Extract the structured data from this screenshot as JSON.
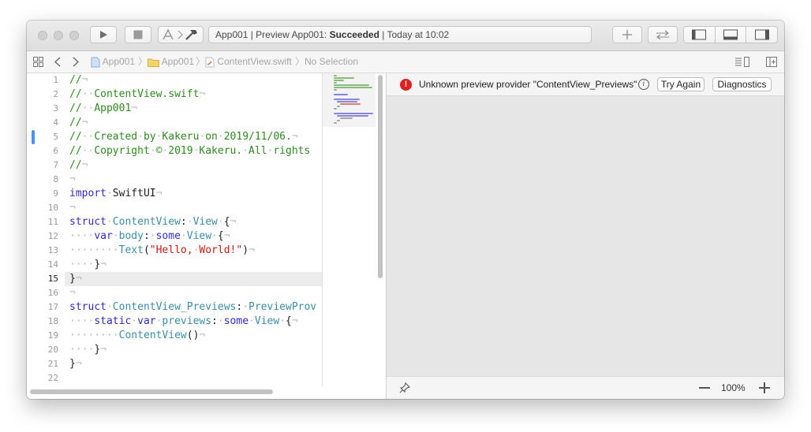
{
  "toolbar": {
    "activity": {
      "prefix": "App001 | Preview App001: ",
      "status": "Succeeded",
      "suffix": " | Today at 10:02"
    }
  },
  "jumpbar": {
    "project": "App001",
    "group": "App001",
    "file": "ContentView.swift",
    "selection": "No Selection"
  },
  "editor": {
    "current_line": 15,
    "lines": [
      {
        "n": "1",
        "text": "//¬"
      },
      {
        "n": "2",
        "text": "//··ContentView.swift¬"
      },
      {
        "n": "3",
        "text": "//··App001¬"
      },
      {
        "n": "4",
        "text": "//¬"
      },
      {
        "n": "5",
        "text": "//··Created·by·Kakeru·on·2019/11/06.¬"
      },
      {
        "n": "6",
        "text": "//··Copyright·©·2019·Kakeru.·All·rights"
      },
      {
        "n": "7",
        "text": "//¬"
      },
      {
        "n": "8",
        "text": "¬"
      },
      {
        "n": "9",
        "text": "import·SwiftUI¬"
      },
      {
        "n": "10",
        "text": "¬"
      },
      {
        "n": "11",
        "text": "struct·ContentView:·View·{¬"
      },
      {
        "n": "12",
        "text": "····var·body:·some·View·{¬"
      },
      {
        "n": "13",
        "text": "········Text(\"Hello,·World!\")¬"
      },
      {
        "n": "14",
        "text": "····}¬"
      },
      {
        "n": "15",
        "text": "}¬"
      },
      {
        "n": "16",
        "text": "¬"
      },
      {
        "n": "17",
        "text": "struct·ContentView_Previews:·PreviewProv"
      },
      {
        "n": "18",
        "text": "····static·var·previews:·some·View·{¬"
      },
      {
        "n": "19",
        "text": "········ContentView()¬"
      },
      {
        "n": "20",
        "text": "····}¬"
      },
      {
        "n": "21",
        "text": "}¬"
      },
      {
        "n": "22",
        "text": ""
      }
    ]
  },
  "preview": {
    "error_message": "Unknown preview provider \"ContentView_Previews\"",
    "try_again_label": "Try Again",
    "diagnostics_label": "Diagnostics",
    "zoom_level": "100%"
  },
  "colors": {
    "comment": "#2f8a1e",
    "keyword": "#2f2cc9",
    "type": "#3b8ea5",
    "string": "#c41a16",
    "invisible": "#b8b8b8",
    "error": "#e0201f",
    "breakpoint_marker": "#4a90f0"
  }
}
